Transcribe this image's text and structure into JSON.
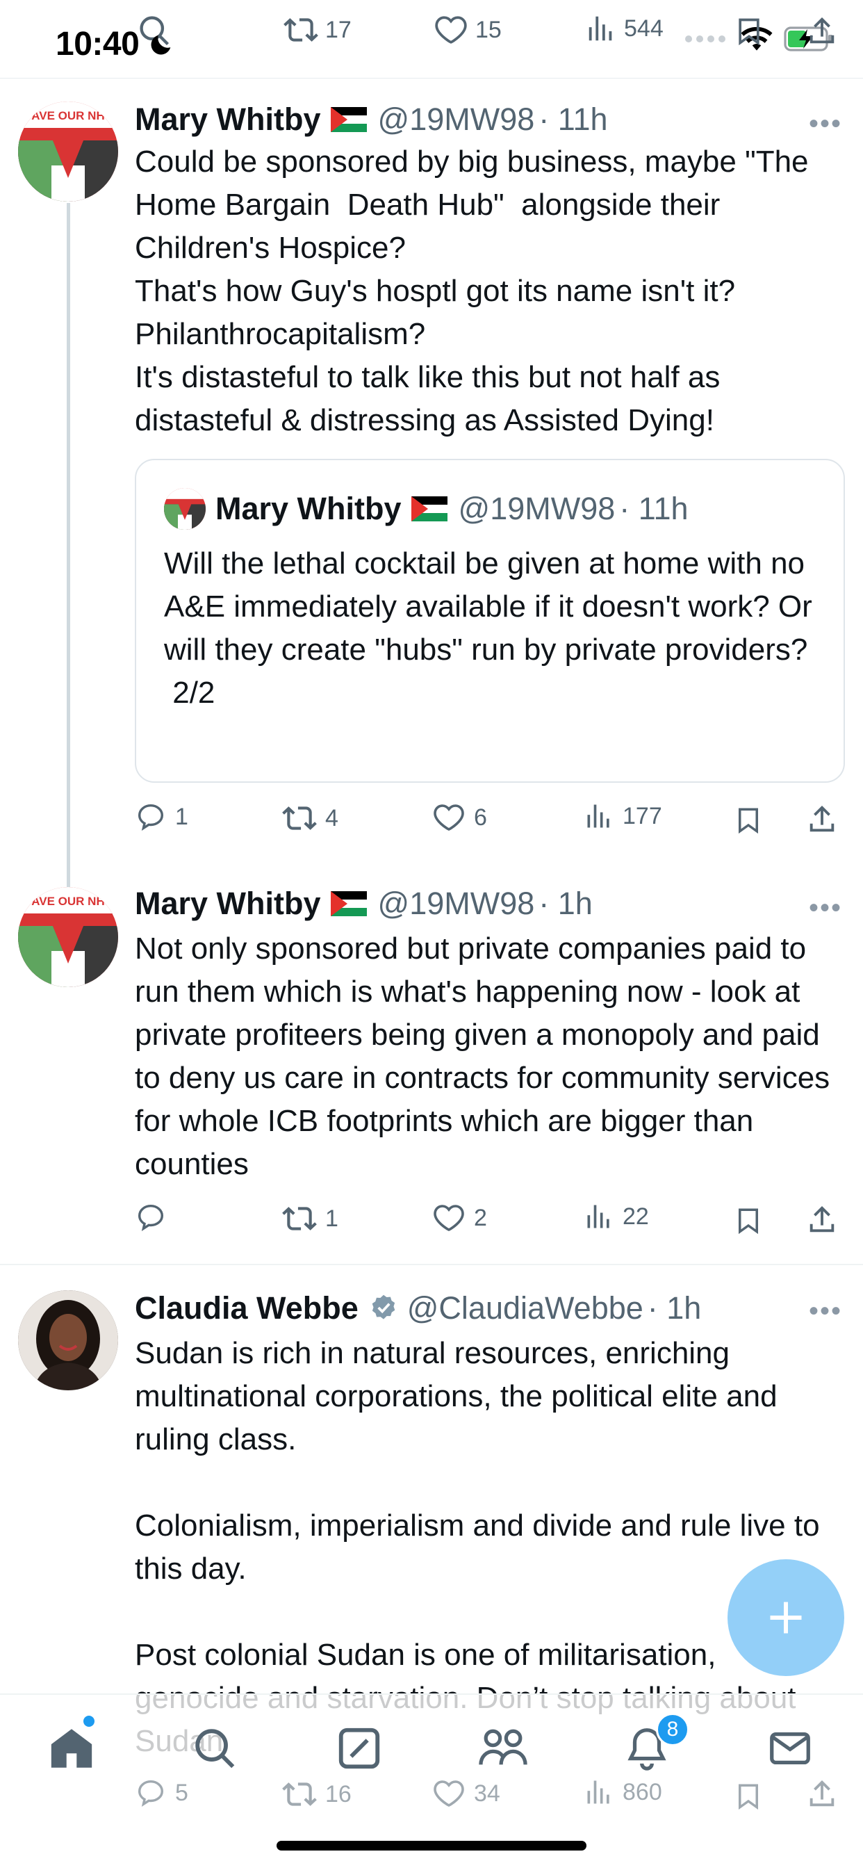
{
  "status_bar": {
    "time": "10:40"
  },
  "ghost_actions": {
    "retweets": "17",
    "likes": "15",
    "views": "544"
  },
  "tweets": [
    {
      "name": "Mary Whitby",
      "handle": "@19MW98",
      "time": "· 11h",
      "avatar_text": "SAVE OUR NHS",
      "body": "Could be sponsored by big business, maybe \"The Home Bargain  Death Hub\"  alongside their Children's Hospice?\nThat's how Guy's hosptl got its name isn't it? Philanthrocapitalism?\nIt's distasteful to talk like this but not half as distasteful & distressing as Assisted Dying!",
      "quote": {
        "name": "Mary Whitby",
        "handle": "@19MW98",
        "time": "· 11h",
        "body": "Will the lethal cocktail be given at home with no A&E immediately available if it doesn't work? Or will they create \"hubs\" run by private providers?\n 2/2"
      },
      "replies": "1",
      "retweets": "4",
      "likes": "6",
      "views": "177"
    },
    {
      "name": "Mary Whitby",
      "handle": "@19MW98",
      "time": "· 1h",
      "avatar_text": "SAVE OUR NHS",
      "body": "Not only sponsored but private companies paid to run them which is what's happening now - look at private profiteers being given a monopoly and paid to deny us care in contracts for community services for whole ICB footprints which are bigger than counties",
      "replies": "",
      "retweets": "1",
      "likes": "2",
      "views": "22"
    },
    {
      "name": "Claudia Webbe",
      "handle": "@ClaudiaWebbe",
      "time": "· 1h",
      "body": "Sudan is rich in natural resources, enriching multinational corporations, the political elite and ruling class.\n\nColonialism, imperialism and divide and rule live to this day.\n\nPost colonial Sudan is one of militarisation, genocide and starvation. Don’t stop talking about Sudan",
      "replies": "5",
      "retweets": "16",
      "likes": "34",
      "views": "860"
    }
  ],
  "bottom_nav": {
    "notifications_badge": "8"
  },
  "colors": {
    "accent": "#1d9bf0",
    "muted": "#536471",
    "verified": "#829aab"
  },
  "icons": [
    "search-icon",
    "retweet-icon",
    "heart-icon",
    "views-icon",
    "bookmark-icon",
    "share-icon",
    "reply-icon",
    "more-icon",
    "verified-icon",
    "plus-icon",
    "home-icon",
    "compose-icon",
    "communities-icon",
    "bell-icon",
    "mail-icon"
  ]
}
